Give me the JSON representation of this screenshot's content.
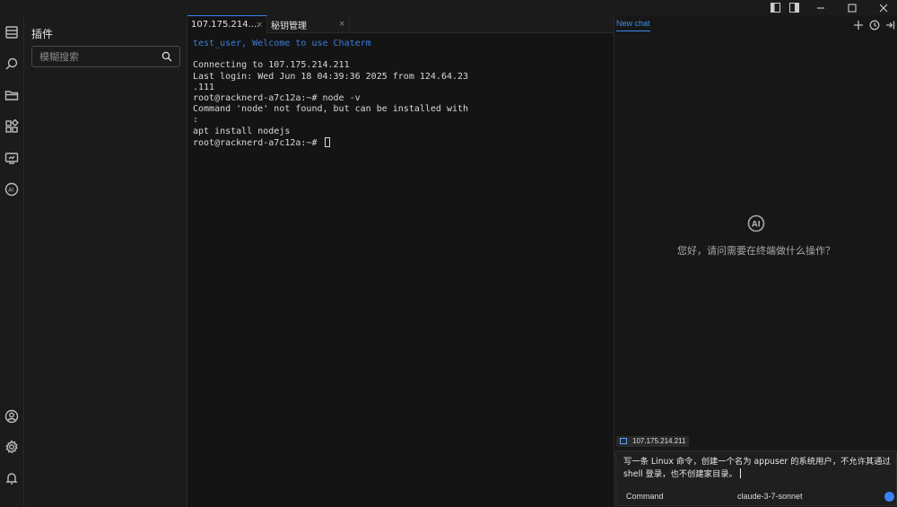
{
  "sidebar_plugins": {
    "title": "插件",
    "search_placeholder": "模糊搜索"
  },
  "activity_bar": {
    "icons": [
      "files-icon",
      "search-icon",
      "folder-icon",
      "extensions-icon",
      "remote-monitor-icon",
      "ai-icon",
      "user-icon",
      "settings-icon",
      "notification-icon"
    ]
  },
  "tabs": [
    {
      "label": "107.175.214....",
      "close": "×"
    },
    {
      "label": "秘钥管理",
      "close": "×"
    }
  ],
  "terminal": {
    "lines": [
      "test_user, Welcome to use Chaterm",
      "",
      "Connecting to 107.175.214.211",
      "Last login: Wed Jun 18 04:39:36 2025 from 124.64.23",
      ".111",
      "root@racknerd-a7c12a:~# node -v",
      "Command 'node' not found, but can be installed with",
      ":",
      "apt install nodejs",
      "root@racknerd-a7c12a:~# "
    ]
  },
  "ai_panel": {
    "tab_label": "New chat",
    "greeting": "您好，请问需要在终端做什么操作？",
    "host_chip": "107.175.214.211",
    "input_text": "写一条 Linux 命令，创建一个名为 appuser 的系统用户，不允许其通过 shell 登录，也不创建家目录。",
    "mode": "Command",
    "model": "claude-3-7-sonnet"
  },
  "colors": {
    "accent": "#3b82f6",
    "welcome_text": "#3b7ddd",
    "background": "#141414"
  }
}
